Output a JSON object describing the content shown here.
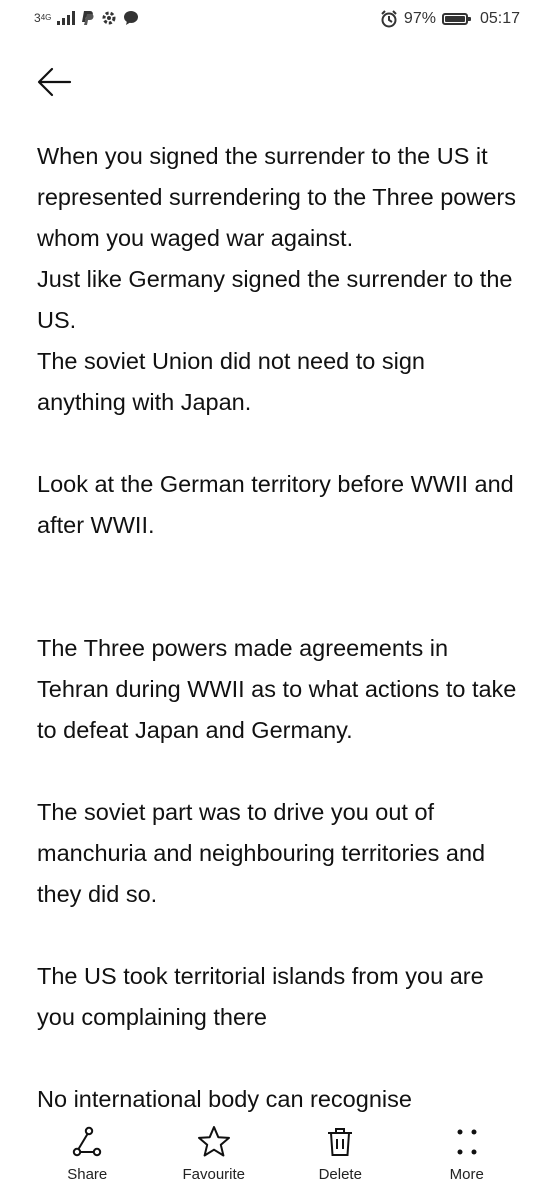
{
  "status_bar": {
    "network": "3",
    "network_sup": "4G",
    "battery": "97%",
    "time": "05:17"
  },
  "note": {
    "paragraphs": [
      "When you signed the surrender to the US it represented surrendering to the Three powers whom you waged war against.\nJust like Germany signed the surrender to the US.\nThe soviet Union did not need to sign anything with Japan.",
      "Look at the German territory before WWII and after WWII.",
      "The Three powers made agreements in Tehran during WWII as to what actions to take to defeat Japan and Germany.",
      "The soviet part was to drive you out of manchuria and neighbouring territories and they did so.",
      "The US took territorial islands from you are you complaining there",
      "No international body can recognise"
    ]
  },
  "toolbar": {
    "share_label": "Share",
    "favourite_label": "Favourite",
    "delete_label": "Delete",
    "more_label": "More"
  },
  "icons": {
    "back": "back-arrow-icon",
    "share": "share-icon",
    "favourite": "star-icon",
    "delete": "trash-icon",
    "more": "more-dots-icon"
  }
}
